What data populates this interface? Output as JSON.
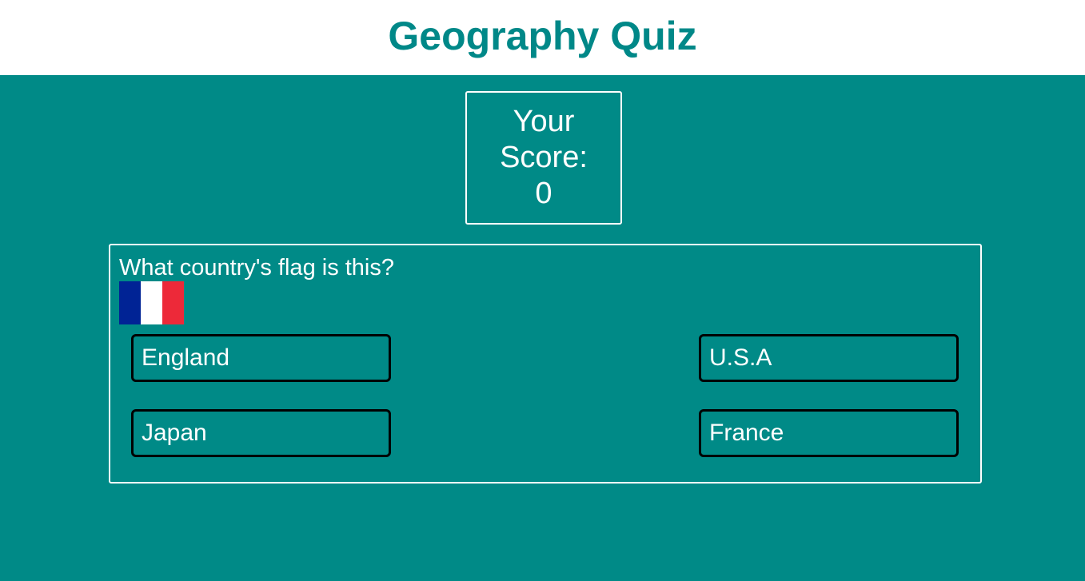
{
  "header": {
    "title": "Geography Quiz"
  },
  "score": {
    "line1": "Your",
    "line2": "Score:",
    "value": "0"
  },
  "question": {
    "text": "What country's flag is this?",
    "flag": {
      "icon": "france-flag-icon",
      "colors": [
        "#002395",
        "#ffffff",
        "#ed2939"
      ]
    }
  },
  "answers": [
    {
      "label": "England"
    },
    {
      "label": "U.S.A"
    },
    {
      "label": "Japan"
    },
    {
      "label": "France"
    }
  ],
  "colors": {
    "accent": "#008888",
    "background": "#008a87",
    "border": "#ffffff",
    "answer_border": "#000000"
  }
}
